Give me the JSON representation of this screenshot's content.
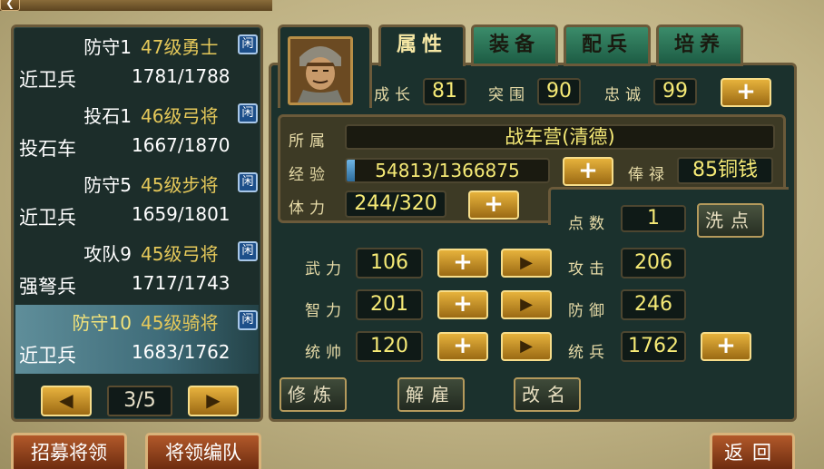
{
  "header": {
    "title": "",
    "back_icon": "back-arrow-icon"
  },
  "generals": [
    {
      "name": "防守1",
      "level": "47级勇士",
      "badge": "闲",
      "type": "近卫兵",
      "troops": "1781/1788",
      "selected": false
    },
    {
      "name": "投石1",
      "level": "46级弓将",
      "badge": "闲",
      "type": "投石车",
      "troops": "1667/1870",
      "selected": false
    },
    {
      "name": "防守5",
      "level": "45级步将",
      "badge": "闲",
      "type": "近卫兵",
      "troops": "1659/1801",
      "selected": false
    },
    {
      "name": "攻队9",
      "level": "45级弓将",
      "badge": "闲",
      "type": "强弩兵",
      "troops": "1717/1743",
      "selected": false
    },
    {
      "name": "防守10",
      "level": "45级骑将",
      "badge": "闲",
      "type": "近卫兵",
      "troops": "1683/1762",
      "selected": true
    }
  ],
  "pager": {
    "text": "3/5",
    "prev": "◀",
    "next": "▶"
  },
  "tabs": [
    "属性",
    "装备",
    "配兵",
    "培养"
  ],
  "growth": {
    "cheng_zhang_label": "成长",
    "cheng_zhang": "81",
    "tu_wei_label": "突围",
    "tu_wei": "90",
    "zhong_cheng_label": "忠诚",
    "zhong_cheng": "99"
  },
  "info": {
    "faction_label": "所属",
    "faction": "战车营(清德)",
    "exp_label": "经验",
    "exp": "54813/1366875",
    "exp_fraction": 0.04,
    "salary_label": "俸禄",
    "salary": "85铜钱",
    "stamina_label": "体力",
    "stamina": "244/320"
  },
  "points": {
    "label": "点数",
    "value": "1",
    "reset_label": "洗点"
  },
  "attributes": [
    {
      "label": "武力",
      "value": "106"
    },
    {
      "label": "智力",
      "value": "201"
    },
    {
      "label": "统帅",
      "value": "120"
    }
  ],
  "combat": [
    {
      "label": "攻击",
      "value": "206"
    },
    {
      "label": "防御",
      "value": "246"
    },
    {
      "label": "统兵",
      "value": "1762"
    }
  ],
  "actions": {
    "train": "修炼",
    "dismiss": "解雇",
    "rename": "改名"
  },
  "footer": {
    "recruit": "招募将领",
    "formation": "将领编队",
    "back": "返回"
  },
  "symbols": {
    "plus": "+",
    "arrow": "▶"
  }
}
